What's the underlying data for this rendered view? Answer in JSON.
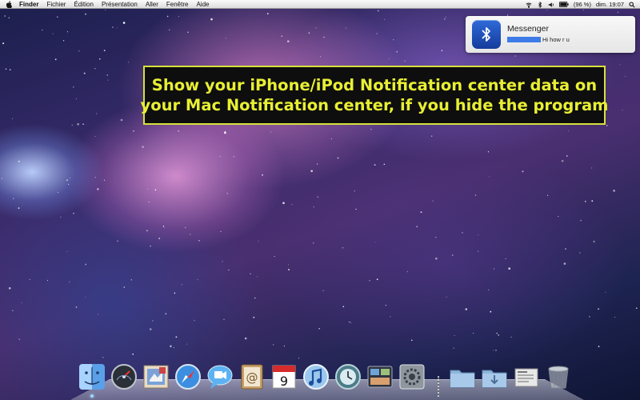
{
  "menubar": {
    "items": [
      "Finder",
      "Fichier",
      "Édition",
      "Présentation",
      "Aller",
      "Fenêtre",
      "Aide"
    ],
    "status": {
      "battery": "(96 %)",
      "clock": "dim. 19:07"
    }
  },
  "notification": {
    "app_name": "Messenger",
    "message": "Hi how r u",
    "icon": "bluetooth-icon"
  },
  "caption": {
    "line1": "Show your iPhone/iPod Notification  center data on",
    "line2": "your Mac Notification center, if you hide the program",
    "text_color": "#e8ef33",
    "border_color": "#d6e13c"
  },
  "dock": {
    "apps": [
      "finder-icon",
      "dashboard-icon",
      "mail-icon",
      "safari-icon",
      "ichat-icon",
      "address-book-icon",
      "ical-icon",
      "itunes-icon",
      "time-machine-icon",
      "mission-control-icon",
      "system-preferences-icon"
    ],
    "ical_date": "9",
    "docs": [
      "applications-folder-icon",
      "downloads-folder-icon",
      "documents-stack-icon",
      "trash-icon"
    ]
  }
}
